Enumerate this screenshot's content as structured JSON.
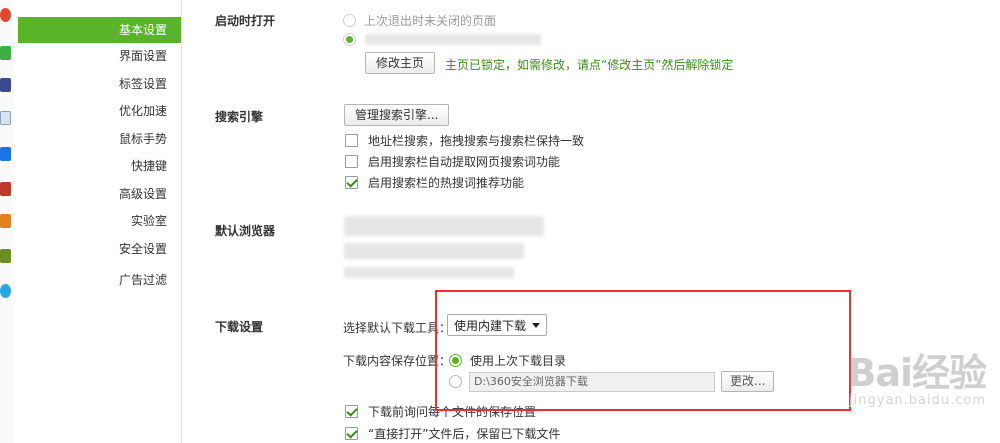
{
  "colors": {
    "accent_green": "#59b32b",
    "note_green": "#3c8b1a",
    "highlight_red": "#e53333"
  },
  "sidebar": {
    "items": [
      {
        "label": "基本设置",
        "active": true
      },
      {
        "label": "界面设置"
      },
      {
        "label": "标签设置"
      },
      {
        "label": "优化加速"
      },
      {
        "label": "鼠标手势"
      },
      {
        "label": "快捷键"
      },
      {
        "label": "高级设置"
      },
      {
        "label": "实验室"
      },
      {
        "label": "安全设置"
      },
      {
        "label": "广告过滤"
      }
    ]
  },
  "startup": {
    "title": "启动时打开",
    "option_last_session": "上次退出时未关闭的页面",
    "edit_home_button": "修改主页",
    "locked_note": "主页已锁定，如需修改，请点“修改主页”然后解除锁定"
  },
  "search": {
    "title": "搜索引擎",
    "manage_button": "管理搜索引擎...",
    "opt_sync_label": "地址栏搜索，拖拽搜索与搜索栏保持一致",
    "opt_sync_checked": false,
    "opt_extract_label": "启用搜索栏自动提取网页搜索词功能",
    "opt_extract_checked": false,
    "opt_hot_label": "启用搜索栏的热搜词推荐功能",
    "opt_hot_checked": true
  },
  "default_browser": {
    "title": "默认浏览器"
  },
  "download": {
    "title": "下载设置",
    "tool_label": "选择默认下载工具：",
    "tool_value": "使用内建下载",
    "save_label": "下载内容保存位置：",
    "opt_last_dir": "使用上次下载目录",
    "path_value": "D:\\360安全浏览器下载",
    "change_button": "更改...",
    "ask_label": "下载前询问每个文件的保存位置",
    "ask_checked": true,
    "keep_label": "“直接打开”文件后，保留已下载文件",
    "keep_checked": true
  },
  "watermark": {
    "main": "Bai经验",
    "sub": "jingyan.baidu.com"
  }
}
